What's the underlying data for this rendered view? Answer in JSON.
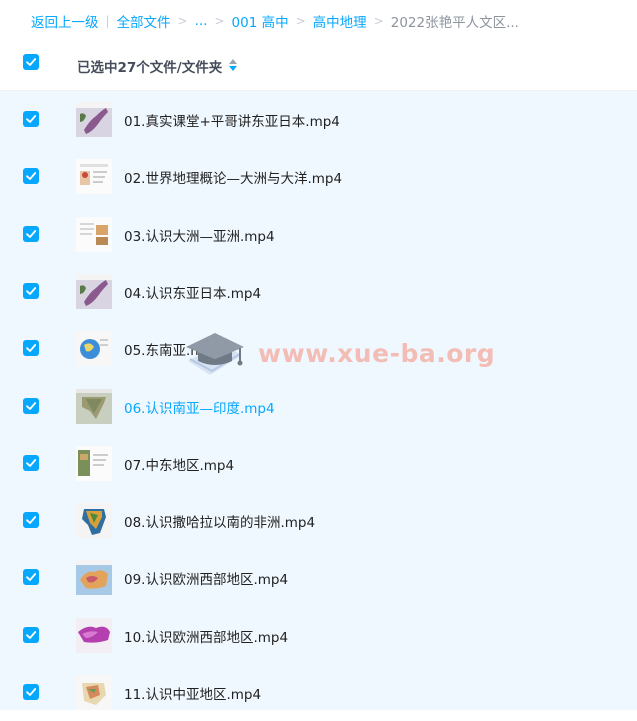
{
  "breadcrumb": {
    "back": "返回上一级",
    "all_files": "全部文件",
    "ellipsis": "...",
    "folder_1": "001 高中",
    "folder_2": "高中地理",
    "current": "2022张艳平人文区..."
  },
  "header": {
    "selected_text": "已选中27个文件/文件夹"
  },
  "files": [
    {
      "name": "01.真实课堂+平哥讲东亚日本.mp4",
      "checked": true,
      "highlight": false,
      "thumb": "map-japan"
    },
    {
      "name": "02.世界地理概论—大洲与大洋.mp4",
      "checked": true,
      "highlight": false,
      "thumb": "slide-intro"
    },
    {
      "name": "03.认识大洲—亚洲.mp4",
      "checked": true,
      "highlight": false,
      "thumb": "slide-asia"
    },
    {
      "name": "04.认识东亚日本.mp4",
      "checked": true,
      "highlight": false,
      "thumb": "map-japan"
    },
    {
      "name": "05.东南亚.mp4",
      "checked": true,
      "highlight": false,
      "thumb": "map-sea"
    },
    {
      "name": "06.认识南亚—印度.mp4",
      "checked": true,
      "highlight": true,
      "thumb": "map-india"
    },
    {
      "name": "07.中东地区.mp4",
      "checked": true,
      "highlight": false,
      "thumb": "slide-mideast"
    },
    {
      "name": "08.认识撒哈拉以南的非洲.mp4",
      "checked": true,
      "highlight": false,
      "thumb": "map-africa"
    },
    {
      "name": "09.认识欧洲西部地区.mp4",
      "checked": true,
      "highlight": false,
      "thumb": "map-europe"
    },
    {
      "name": "10.认识欧洲西部地区.mp4",
      "checked": true,
      "highlight": false,
      "thumb": "map-russia"
    },
    {
      "name": "11.认识中亚地区.mp4",
      "checked": true,
      "highlight": false,
      "thumb": "map-central-asia"
    }
  ],
  "watermark": {
    "text": "www.xue-ba.org",
    "icon": "graduation-cap-icon"
  },
  "colors": {
    "accent": "#06a7ff",
    "list_bg": "#f0f8ff",
    "breadcrumb_current": "#8d949e"
  }
}
